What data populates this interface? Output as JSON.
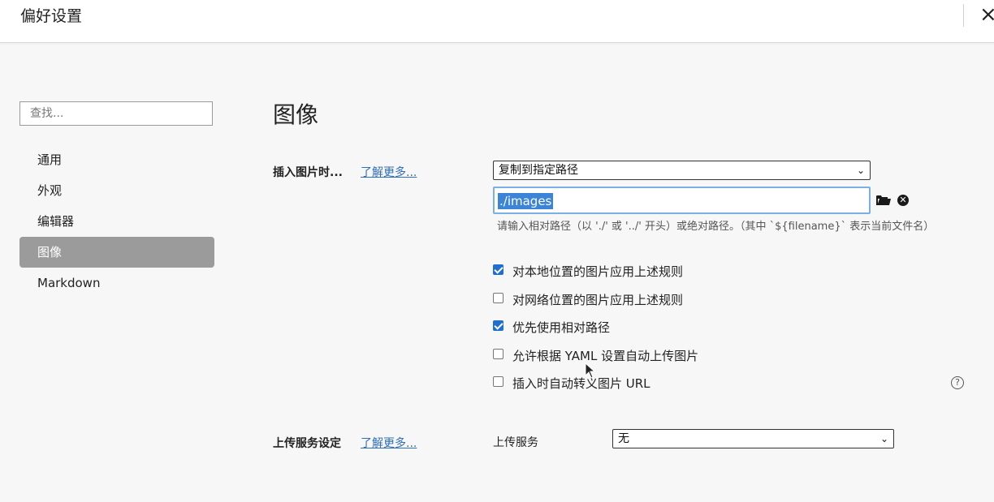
{
  "window": {
    "title": "偏好设置",
    "close_icon": "×"
  },
  "sidebar": {
    "search_placeholder": "查找...",
    "items": [
      {
        "label": "通用"
      },
      {
        "label": "外观"
      },
      {
        "label": "编辑器"
      },
      {
        "label": "图像",
        "active": true
      },
      {
        "label": "Markdown"
      }
    ]
  },
  "main": {
    "title": "图像",
    "insert": {
      "label": "插入图片时...",
      "learn_more": "了解更多...",
      "action_selected": "复制到指定路径",
      "path_value": "./images",
      "hint": "请输入相对路径（以 './' 或 '../' 开头）或绝对路径。（其中 `${filename}` 表示当前文件名）",
      "options": [
        {
          "label": "对本地位置的图片应用上述规则",
          "checked": true
        },
        {
          "label": "对网络位置的图片应用上述规则",
          "checked": false
        },
        {
          "label": "优先使用相对路径",
          "checked": true
        },
        {
          "label": "允许根据 YAML 设置自动上传图片",
          "checked": false
        },
        {
          "label": "插入时自动转义图片 URL",
          "checked": false
        }
      ]
    },
    "upload": {
      "label": "上传服务设定",
      "learn_more": "了解更多...",
      "service_label": "上传服务",
      "service_selected": "无"
    }
  },
  "colors": {
    "accent": "#1f6fd1",
    "link": "#2f6fb5",
    "active_nav": "#9b9b9b",
    "selection": "#3b84d8"
  }
}
